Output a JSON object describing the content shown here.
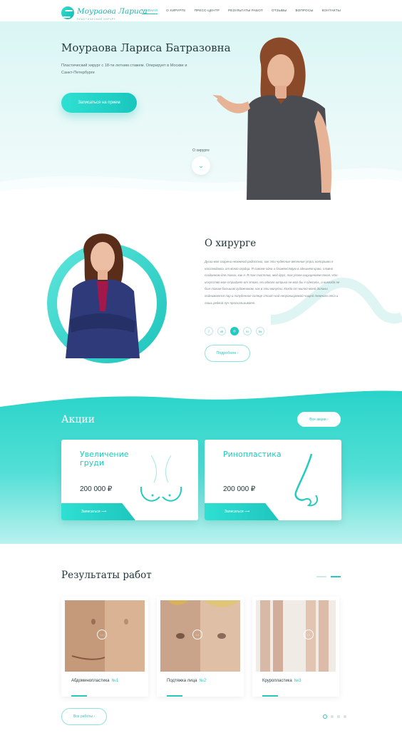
{
  "header": {
    "logo_title": "Моураова Лариса",
    "logo_subtitle": "пластический хирург",
    "nav": [
      {
        "label": "Главная",
        "active": true
      },
      {
        "label": "О хирурге"
      },
      {
        "label": "Пресс-центр"
      },
      {
        "label": "Результаты работ"
      },
      {
        "label": "Отзывы"
      },
      {
        "label": "Вопросы"
      },
      {
        "label": "Контакты"
      }
    ]
  },
  "hero": {
    "title": "Моураова Лариса Батразовна",
    "description": "Пластический хирург с 18-ти летним стажем. Оперирует в Москве и Санкт-Петербурге",
    "cta": "Записаться на прием",
    "scroll_label": "О хирурге",
    "scroll_icon": "chevron-down-icon"
  },
  "about": {
    "title": "О хирурге",
    "text": "Душа моя озарена неземной радостью, как эти чудесные весенние утра, которыми я наслаждаюсь от всего сердца. Я совсем одна и блаженствую в здешнем краю, словно созданном для таких, как я. Я так счастлив, мой друг, так упоен ощущением покоя, что искусство мое страдает от этого. Ни одного штриха не мог бы я сделать, а никогда не был таким большим художником, как в эти минуты. Когда от милой моей долины поднимается пар и полуденное солнце стоит над непроницаемой чащей темного леса и лишь редкий луч проскальзывает.",
    "socials": [
      {
        "label": "f",
        "icon": "facebook-icon"
      },
      {
        "label": "vk",
        "icon": "vk-icon"
      },
      {
        "label": "◎",
        "icon": "instagram-icon"
      },
      {
        "label": "in",
        "icon": "linkedin-icon"
      },
      {
        "label": "tw",
        "icon": "twitter-icon"
      }
    ],
    "more_button": "Подробнее ›"
  },
  "promo": {
    "title": "Акции",
    "all_button": "Все акции ›",
    "cards": [
      {
        "title": "Увеличение груди",
        "price": "200 000 ₽",
        "cta": "Записаться ⟶",
        "art": "breast-outline-icon"
      },
      {
        "title": "Ринопластика",
        "price": "200 000 ₽",
        "cta": "Записаться ⟶",
        "art": "nose-outline-icon"
      }
    ]
  },
  "results": {
    "title": "Результаты работ",
    "cards": [
      {
        "label": "Абдоминопластика",
        "num": "№1",
        "handle": "‹ ›"
      },
      {
        "label": "Подтяжка лица",
        "num": "№2",
        "handle": "‹ ›"
      },
      {
        "label": "Круропластика",
        "num": "№3",
        "handle": "‹ ›"
      }
    ],
    "all_button": "Все работы ›",
    "page_count": 4,
    "active_page": 1
  },
  "colors": {
    "accent": "#22c9bd",
    "dark_text": "#23373b",
    "hero_bg": "#dff7f5"
  }
}
